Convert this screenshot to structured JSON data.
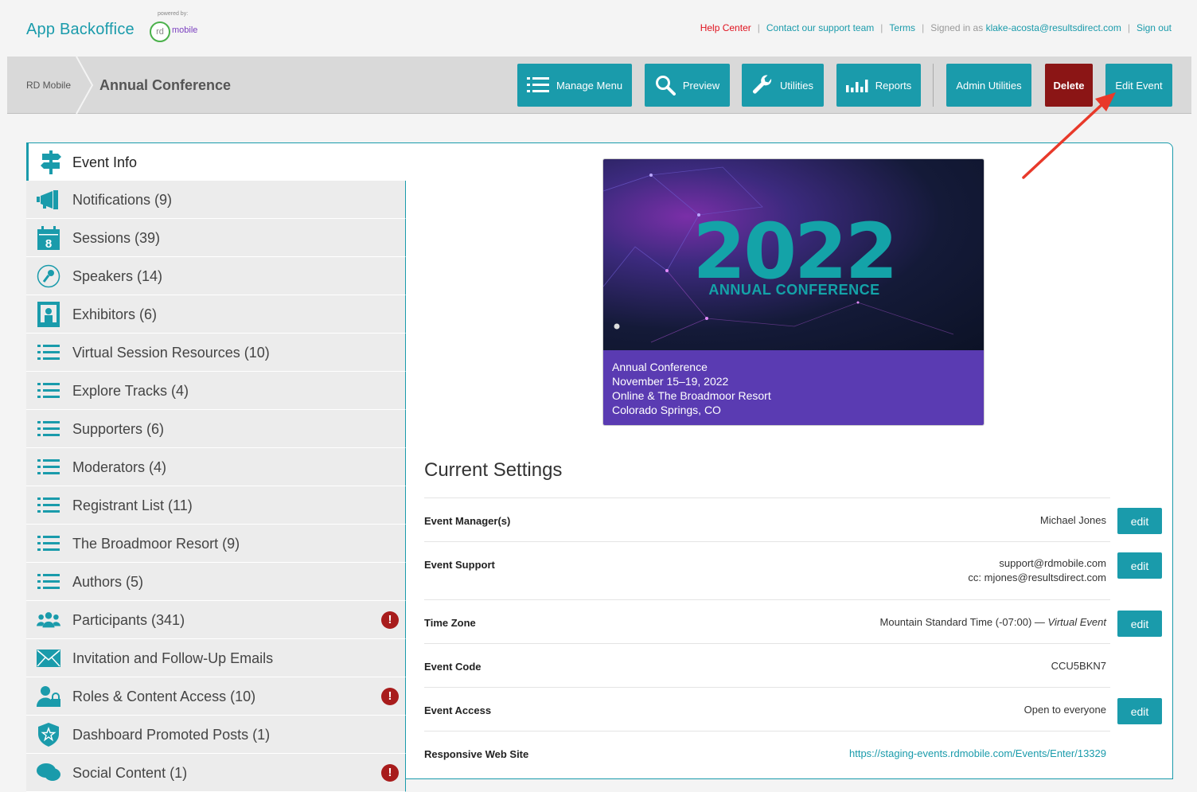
{
  "header": {
    "brand": "App Backoffice",
    "powered_by": "powered by:",
    "logo_rd": "rd",
    "logo_mobile": "mobile",
    "help_center": "Help Center",
    "contact": "Contact our support team",
    "terms": "Terms",
    "signed_in_prefix": "Signed in as",
    "user_email": "klake-acosta@resultsdirect.com",
    "sign_out": "Sign out",
    "separator": "|"
  },
  "toolbar": {
    "crumb_root": "RD Mobile",
    "crumb_current": "Annual Conference",
    "manage_menu": "Manage Menu",
    "preview": "Preview",
    "utilities": "Utilities",
    "reports": "Reports",
    "admin_utilities": "Admin Utilities",
    "delete": "Delete",
    "edit_event": "Edit Event"
  },
  "sidebar": {
    "items": [
      {
        "label": "Event Info",
        "icon": "signpost-icon"
      },
      {
        "label": "Notifications (9)",
        "icon": "megaphone-icon"
      },
      {
        "label": "Sessions (39)",
        "icon": "calendar-icon"
      },
      {
        "label": "Speakers (14)",
        "icon": "microphone-icon"
      },
      {
        "label": "Exhibitors (6)",
        "icon": "booth-icon"
      },
      {
        "label": "Virtual Session Resources (10)",
        "icon": "list-icon"
      },
      {
        "label": "Explore Tracks (4)",
        "icon": "list-icon"
      },
      {
        "label": "Supporters (6)",
        "icon": "list-icon"
      },
      {
        "label": "Moderators (4)",
        "icon": "list-icon"
      },
      {
        "label": "Registrant List (11)",
        "icon": "list-icon"
      },
      {
        "label": "The Broadmoor Resort (9)",
        "icon": "list-icon"
      },
      {
        "label": "Authors (5)",
        "icon": "list-icon"
      },
      {
        "label": "Participants (341)",
        "icon": "people-icon"
      },
      {
        "label": "Invitation and Follow-Up Emails",
        "icon": "envelope-icon"
      },
      {
        "label": "Roles & Content Access (10)",
        "icon": "user-lock-icon"
      },
      {
        "label": "Dashboard Promoted Posts (1)",
        "icon": "shield-star-icon"
      },
      {
        "label": "Social Content (1)",
        "icon": "chat-icon"
      }
    ],
    "alert_mark": "!"
  },
  "banner": {
    "year": "2022",
    "subtitle": "ANNUAL CONFERENCE",
    "line1": "Annual Conference",
    "line2": "November 15–19, 2022",
    "line3": "Online & The Broadmoor Resort",
    "line4": "Colorado Springs, CO"
  },
  "settings": {
    "title": "Current Settings",
    "edit_label": "edit",
    "rows": {
      "manager": {
        "label": "Event Manager(s)",
        "value": "Michael Jones"
      },
      "support": {
        "label": "Event Support",
        "value": "support@rdmobile.com",
        "value2": "cc: mjones@resultsdirect.com"
      },
      "timezone": {
        "label": "Time Zone",
        "value": "Mountain Standard Time (-07:00) —",
        "value_italic": "Virtual Event"
      },
      "code": {
        "label": "Event Code",
        "value": "CCU5BKN7"
      },
      "access": {
        "label": "Event Access",
        "value": "Open to everyone"
      },
      "website": {
        "label": "Responsive Web Site",
        "value": "https://staging-events.rdmobile.com/Events/Enter/13329"
      }
    }
  },
  "colors": {
    "accent": "#1a9bab",
    "delete": "#8b1515",
    "alert": "#a81c1c",
    "help": "#e0121e",
    "banner_purple": "#5a3bb2"
  }
}
